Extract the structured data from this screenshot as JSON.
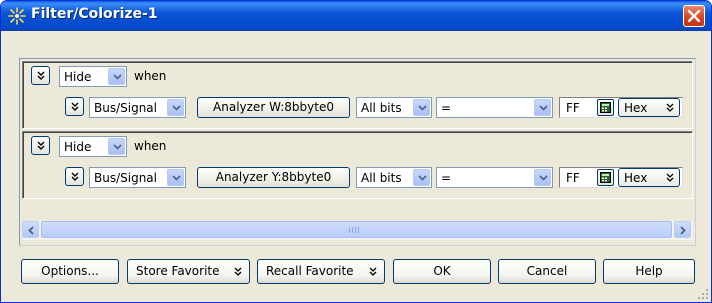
{
  "window": {
    "title": "Filter/Colorize-1"
  },
  "rules": [
    {
      "action": "Hide",
      "when_label": "when",
      "source_type": "Bus/Signal",
      "source_name": "Analyzer W:8bbyte0",
      "bits": "All bits",
      "operator": "=",
      "value": "FF",
      "radix": "Hex"
    },
    {
      "action": "Hide",
      "when_label": "when",
      "source_type": "Bus/Signal",
      "source_name": "Analyzer Y:8bbyte0",
      "bits": "All bits",
      "operator": "=",
      "value": "FF",
      "radix": "Hex"
    }
  ],
  "buttons": {
    "options": "Options...",
    "store_favorite": "Store Favorite",
    "recall_favorite": "Recall Favorite",
    "ok": "OK",
    "cancel": "Cancel",
    "help": "Help"
  },
  "icons": {
    "title": "filter-sparkle-icon",
    "close": "close-icon",
    "expand": "double-chevron-down-icon",
    "calculator": "calculator-icon"
  },
  "colors": {
    "titlebar": "#0a55d6",
    "dialog_bg": "#ece9d8",
    "close_button": "#d4441f",
    "combo_arrow": "#a9c0f6"
  }
}
